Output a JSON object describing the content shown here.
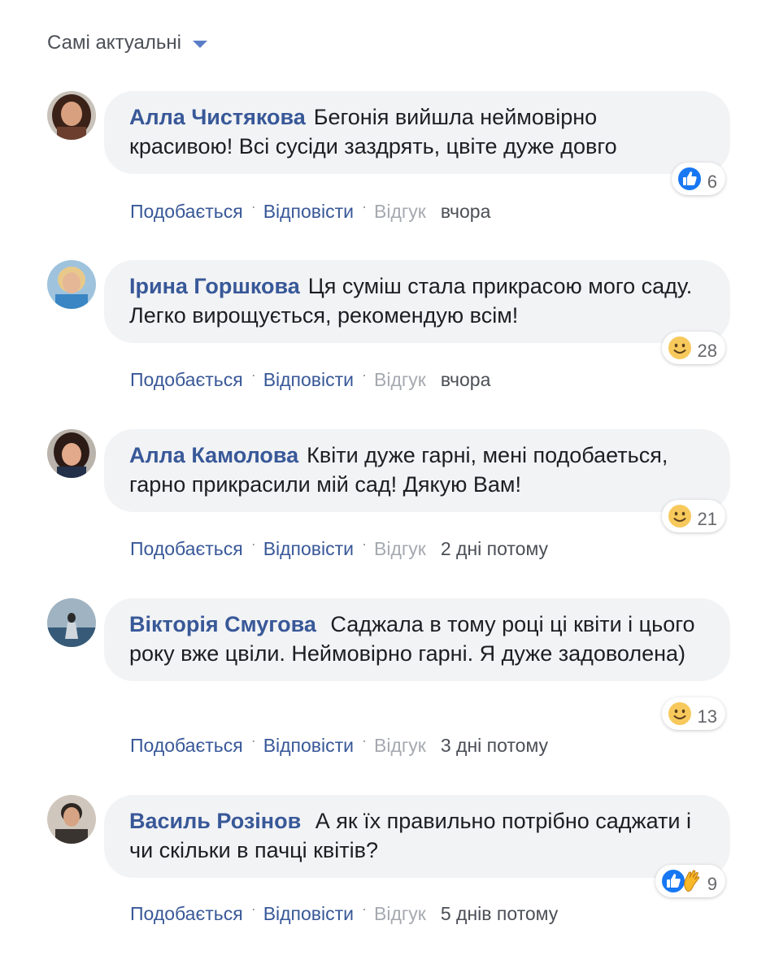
{
  "sort": {
    "label": "Самі актуальні"
  },
  "comments": [
    {
      "author": "Алла Чистякова",
      "text": "Бегонія вийшла неймовірно красивою! Всі сусіди заздрять, цвіте дуже довго",
      "reactions": {
        "types": [
          "like"
        ],
        "count": "6"
      },
      "actions": {
        "like": "Подобається",
        "reply": "Відповісти",
        "feedback": "Відгук"
      },
      "time": "вчора"
    },
    {
      "author": "Ірина Горшкова",
      "text": "Ця суміш стала прикрасою мого саду. Легко вирощується, рекомендую всім!",
      "reactions": {
        "types": [
          "smile"
        ],
        "count": "28"
      },
      "actions": {
        "like": "Подобається",
        "reply": "Відповісти",
        "feedback": "Відгук"
      },
      "time": "вчора"
    },
    {
      "author": "Алла Камолова",
      "text": "Квіти дуже гарні, мені подобаеться, гарно прикрасили мій сад! Дякую Вам!",
      "reactions": {
        "types": [
          "smile"
        ],
        "count": "21"
      },
      "actions": {
        "like": "Подобається",
        "reply": "Відповісти",
        "feedback": "Відгук"
      },
      "time": "2 дні потому"
    },
    {
      "author": "Вікторія Смугова",
      "text": " Саджала в тому році ці квіти і цього року вже цвіли. Неймовірно гарні. Я дуже задоволена)",
      "reactions": {
        "types": [
          "smile"
        ],
        "count": "13"
      },
      "actions": {
        "like": "Подобається",
        "reply": "Відповісти",
        "feedback": "Відгук"
      },
      "time": "3 дні потому"
    },
    {
      "author": "Василь Розінов",
      "text": " А як їх правильно потрібно саджати і чи скільки в пачці квітів?",
      "reactions": {
        "types": [
          "like",
          "clap"
        ],
        "count": "9"
      },
      "actions": {
        "like": "Подобається",
        "reply": "Відповісти",
        "feedback": "Відгук"
      },
      "time": "5 днів потому"
    }
  ],
  "colors": {
    "author": "#385898",
    "bubble": "#f2f3f5",
    "like_icon": "#1877f2",
    "smile_icon": "#f7c95c",
    "caret": "#5b7dc7"
  },
  "icons": {
    "sort_caret": "chevron-down-icon",
    "like": "thumbs-up-icon",
    "smile": "smile-emoji-icon",
    "clap": "clap-hand-icon"
  }
}
